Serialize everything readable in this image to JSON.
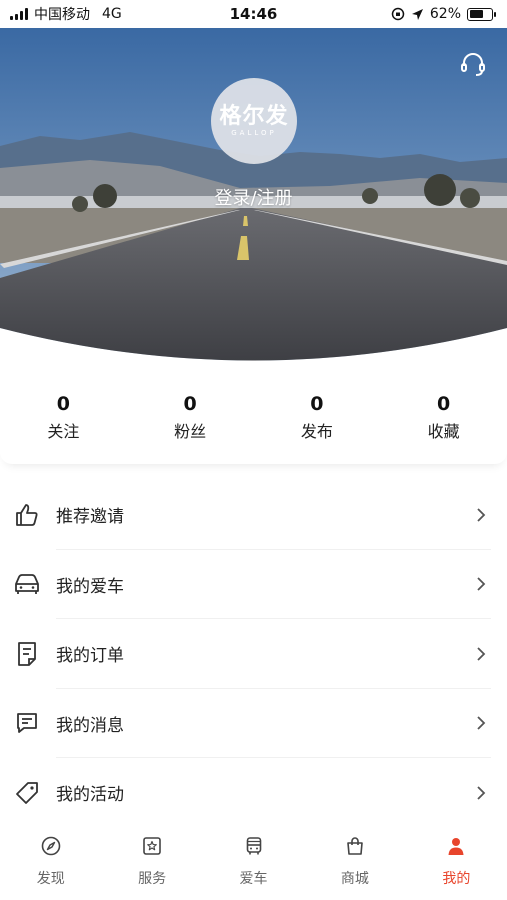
{
  "status_bar": {
    "carrier": "中国移动",
    "network": "4G",
    "time": "14:46",
    "battery_text": "62%",
    "battery_level": 0.62
  },
  "hero": {
    "logo_mark": "格尔发",
    "logo_sub": "GALLOP",
    "login_text": "登录/注册",
    "support_icon": "headset-icon"
  },
  "stats": [
    {
      "value": "0",
      "label": "关注"
    },
    {
      "value": "0",
      "label": "粉丝"
    },
    {
      "value": "0",
      "label": "发布"
    },
    {
      "value": "0",
      "label": "收藏"
    }
  ],
  "menu": [
    {
      "label": "推荐邀请",
      "icon": "thumbs-up-icon"
    },
    {
      "label": "我的爱车",
      "icon": "car-icon"
    },
    {
      "label": "我的订单",
      "icon": "order-icon"
    },
    {
      "label": "我的消息",
      "icon": "message-icon"
    },
    {
      "label": "我的活动",
      "icon": "tag-icon"
    }
  ],
  "tabs": [
    {
      "label": "发现",
      "icon": "compass-icon",
      "active": false
    },
    {
      "label": "服务",
      "icon": "service-icon",
      "active": false
    },
    {
      "label": "爱车",
      "icon": "bus-icon",
      "active": false
    },
    {
      "label": "商城",
      "icon": "shopping-bag-icon",
      "active": false
    },
    {
      "label": "我的",
      "icon": "person-icon",
      "active": true
    }
  ],
  "colors": {
    "accent": "#e8452c",
    "tab_inactive": "#666666",
    "sky_top": "#3f6fa8",
    "road": "#4b4c52"
  }
}
